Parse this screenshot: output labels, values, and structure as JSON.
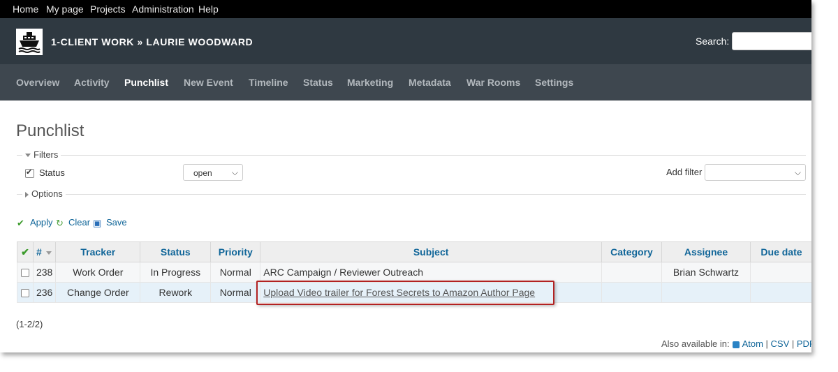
{
  "top_menu": {
    "items": [
      "Home",
      "My page",
      "Projects",
      "Administration",
      "Help"
    ]
  },
  "header": {
    "project_title": "1-CLIENT WORK » LAURIE WOODWARD",
    "search_label": "Search:",
    "search_value": ""
  },
  "main_menu": {
    "items": [
      "Overview",
      "Activity",
      "Punchlist",
      "New Event",
      "Timeline",
      "Status",
      "Marketing",
      "Metadata",
      "War Rooms",
      "Settings"
    ],
    "selected": "Punchlist"
  },
  "page": {
    "title": "Punchlist"
  },
  "filters": {
    "legend": "Filters",
    "status_checked": true,
    "status_label": "Status",
    "status_operator": "open",
    "add_filter_label": "Add filter",
    "add_filter_value": ""
  },
  "options": {
    "legend": "Options"
  },
  "actions": {
    "apply": "Apply",
    "clear": "Clear",
    "save": "Save"
  },
  "table": {
    "columns": [
      "#",
      "Tracker",
      "Status",
      "Priority",
      "Subject",
      "Category",
      "Assignee",
      "Due date"
    ],
    "rows": [
      {
        "id": "238",
        "tracker": "Work Order",
        "status": "In Progress",
        "priority": "Normal",
        "subject": "ARC Campaign / Reviewer Outreach",
        "category": "",
        "assignee": "Brian Schwartz",
        "due_date": ""
      },
      {
        "id": "236",
        "tracker": "Change Order",
        "status": "Rework",
        "priority": "Normal",
        "subject": "Upload Video trailer for Forest Secrets to Amazon Author Page",
        "category": "",
        "assignee": "",
        "due_date": ""
      }
    ]
  },
  "pagination": "(1-2/2)",
  "other_formats": {
    "label": "Also available in:",
    "atom": "Atom",
    "csv": "CSV",
    "pdf": "PDF"
  },
  "colors": {
    "top_bar": "#000000",
    "header": "#2f3941",
    "main_menu": "#3e474f",
    "link": "#116699",
    "highlight_box": "#b22222"
  }
}
